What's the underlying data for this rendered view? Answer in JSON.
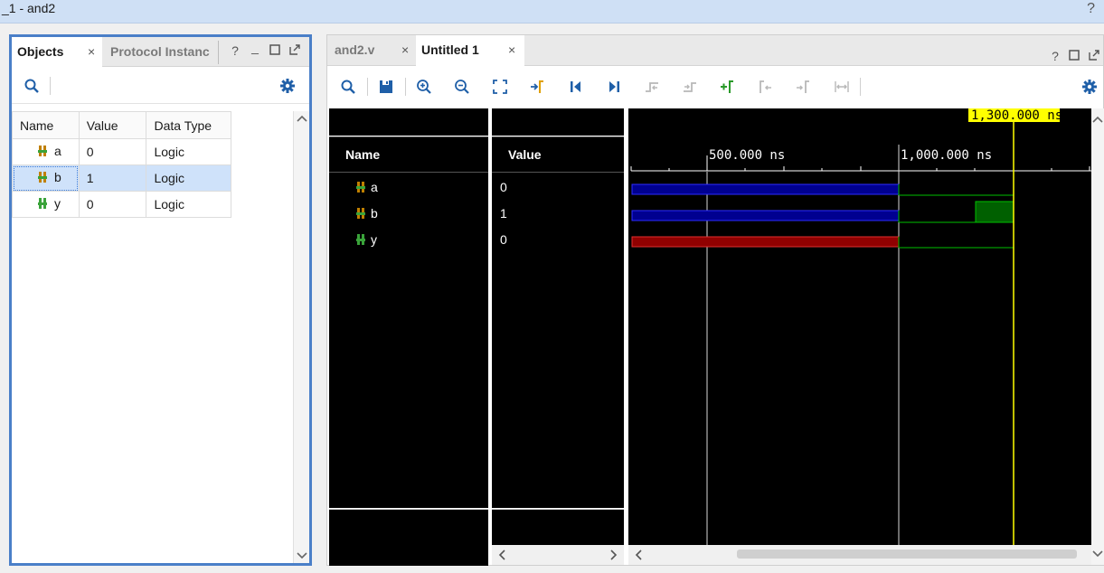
{
  "window": {
    "title": "_1 - and2",
    "help": "?"
  },
  "objects_panel": {
    "tabs": [
      {
        "label": "Objects",
        "close": "×"
      },
      {
        "label": "Protocol Instanc"
      }
    ],
    "controls": {
      "help": "?",
      "minimize": "_"
    },
    "columns": [
      "Name",
      "Value",
      "Data Type"
    ],
    "rows": [
      {
        "name": "a",
        "value": "0",
        "type": "Logic"
      },
      {
        "name": "b",
        "value": "1",
        "type": "Logic"
      },
      {
        "name": "y",
        "value": "0",
        "type": "Logic"
      }
    ],
    "selected_row": 1
  },
  "wave_panel": {
    "tabs": [
      {
        "label": "and2.v",
        "close": "×"
      },
      {
        "label": "Untitled 1",
        "close": "×"
      }
    ],
    "controls": {
      "help": "?"
    },
    "name_header": "Name",
    "value_header": "Value",
    "signals": [
      {
        "name": "a",
        "value": "0"
      },
      {
        "name": "b",
        "value": "1"
      },
      {
        "name": "y",
        "value": "0"
      }
    ],
    "time_labels": {
      "t500": "500.000 ns",
      "t1000": "1,000.000 ns"
    },
    "cursor_label": "1,300.000 ns",
    "colors": {
      "cursor": "#ffff00",
      "high": "#00c000",
      "undefined": "#c00000",
      "zvalue": "#0000c0"
    }
  }
}
